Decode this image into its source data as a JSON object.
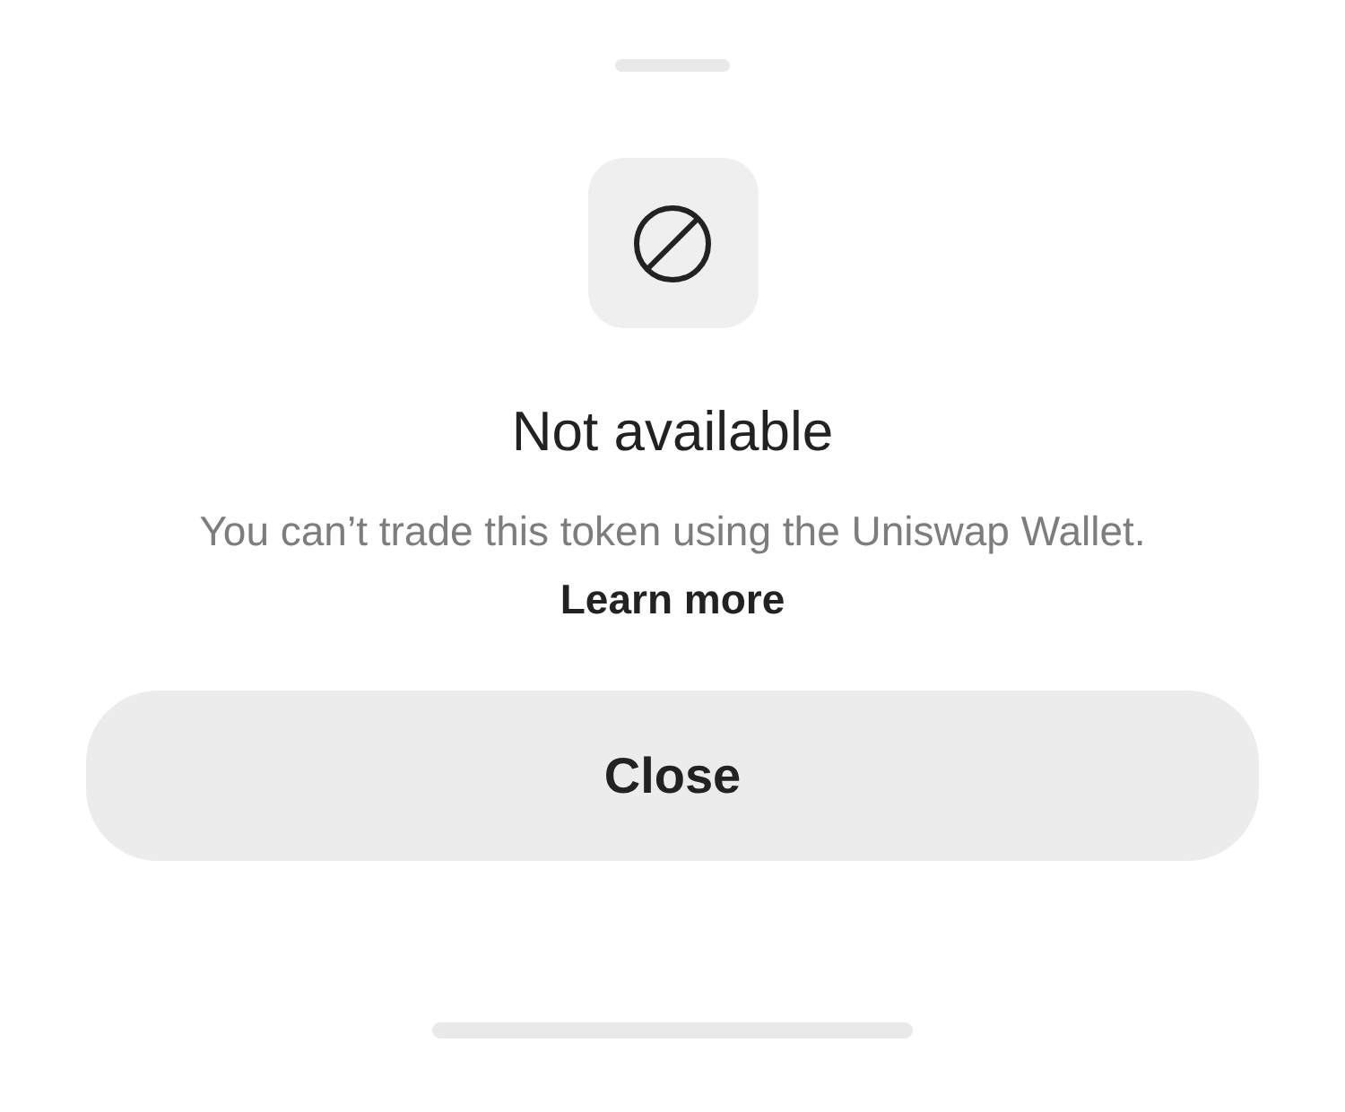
{
  "title": "Not available",
  "message": "You can’t trade this token using the Uniswap Wallet.",
  "link": "Learn more",
  "button": "Close"
}
